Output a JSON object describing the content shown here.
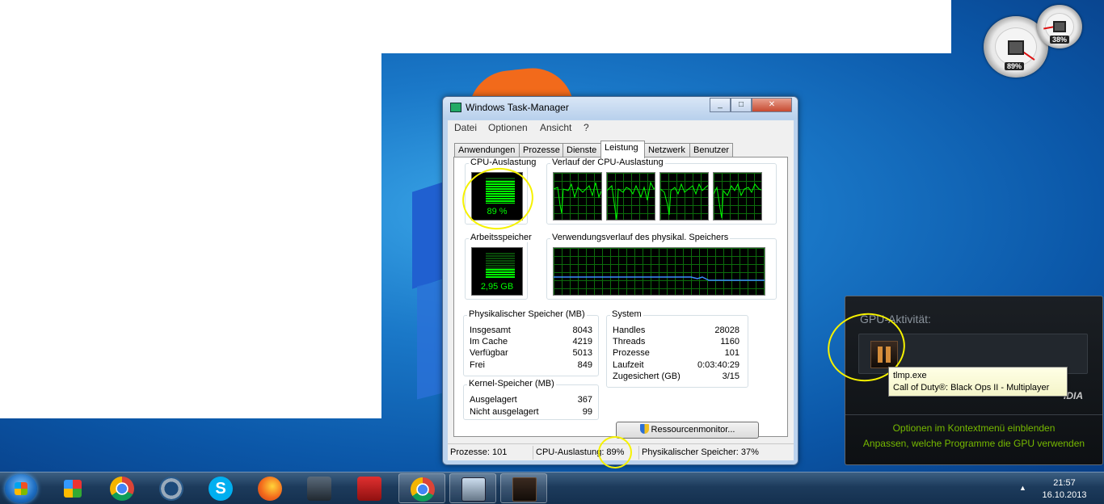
{
  "window": {
    "title": "Windows Task-Manager",
    "controls": [
      "minimize",
      "maximize",
      "close"
    ]
  },
  "menu": [
    "Datei",
    "Optionen",
    "Ansicht",
    "?"
  ],
  "tabs": [
    "Anwendungen",
    "Prozesse",
    "Dienste",
    "Leistung",
    "Netzwerk",
    "Benutzer"
  ],
  "active_tab": "Leistung",
  "cpu": {
    "group_title": "CPU-Auslastung",
    "value_label": "89 %",
    "fraction": 0.89,
    "history_title": "Verlauf der CPU-Auslastung"
  },
  "memory": {
    "group_title": "Arbeitsspeicher",
    "value_label": "2,95 GB",
    "fraction": 0.37,
    "history_title": "Verwendungsverlauf des physikal. Speichers"
  },
  "physical": {
    "title": "Physikalischer Speicher (MB)",
    "rows": [
      {
        "label": "Insgesamt",
        "value": "8043"
      },
      {
        "label": "Im Cache",
        "value": "4219"
      },
      {
        "label": "Verfügbar",
        "value": "5013"
      },
      {
        "label": "Frei",
        "value": "849"
      }
    ]
  },
  "kernel": {
    "title": "Kernel-Speicher (MB)",
    "rows": [
      {
        "label": "Ausgelagert",
        "value": "367"
      },
      {
        "label": "Nicht ausgelagert",
        "value": "99"
      }
    ]
  },
  "system": {
    "title": "System",
    "rows": [
      {
        "label": "Handles",
        "value": "28028"
      },
      {
        "label": "Threads",
        "value": "1160"
      },
      {
        "label": "Prozesse",
        "value": "101"
      },
      {
        "label": "Laufzeit",
        "value": "0:03:40:29"
      },
      {
        "label": "Zugesichert (GB)",
        "value": "3/15"
      }
    ]
  },
  "resource_button": "Ressourcenmonitor...",
  "statusbar": {
    "processes": "Prozesse: 101",
    "cpu": "CPU-Auslastung: 89%",
    "memory": "Physikalischer Speicher: 37%"
  },
  "gadget": {
    "cpu_pct": "89%",
    "mem_pct": "38%"
  },
  "nvidia": {
    "title": "GPU-Aktivität:",
    "logo": "IDIA",
    "link1": "Optionen im Kontextmenü einblenden",
    "link2": "Anpassen, welche Programme die GPU verwenden",
    "accent": "#76b900"
  },
  "tooltip": {
    "line1": "tlmp.exe",
    "line2": "Call of Duty®: Black Ops II - Multiplayer"
  },
  "taskbar": {
    "icons": [
      "start-menu-icon",
      "app-grid-icon",
      "chrome-icon",
      "teamspeak-icon",
      "skype-icon",
      "firefox-icon",
      "steam-icon",
      "mp3-icon",
      "chrome-icon",
      "task-manager-icon",
      "black-ops-icon"
    ],
    "time": "21:57",
    "date": "16.10.2013"
  },
  "colors": {
    "graph_green": "#00ff00",
    "annotation_yellow": "#f6f200",
    "desktop_blue": "#1a78c8"
  }
}
